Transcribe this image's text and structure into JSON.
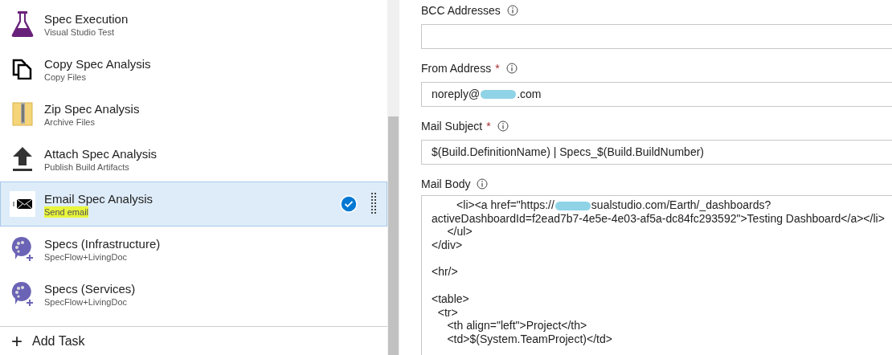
{
  "tasks": [
    {
      "title": "Spec Execution",
      "subtitle": "Visual Studio Test",
      "kind": "flask",
      "selected": false,
      "highlighted": false
    },
    {
      "title": "Copy Spec Analysis",
      "subtitle": "Copy Files",
      "kind": "copy",
      "selected": false,
      "highlighted": false
    },
    {
      "title": "Zip Spec Analysis",
      "subtitle": "Archive Files",
      "kind": "zip",
      "selected": false,
      "highlighted": false
    },
    {
      "title": "Attach Spec Analysis",
      "subtitle": "Publish Build Artifacts",
      "kind": "upload",
      "selected": false,
      "highlighted": false
    },
    {
      "title": "Email Spec Analysis",
      "subtitle": "Send email",
      "kind": "email",
      "selected": true,
      "highlighted": true
    },
    {
      "title": "Specs (Infrastructure)",
      "subtitle": "SpecFlow+LivingDoc",
      "kind": "specflow",
      "selected": false,
      "highlighted": false
    },
    {
      "title": "Specs (Services)",
      "subtitle": "SpecFlow+LivingDoc",
      "kind": "specflow",
      "selected": false,
      "highlighted": false
    }
  ],
  "add_task": {
    "icon": "+",
    "label": "Add Task"
  },
  "fields": [
    {
      "label": "BCC Addresses",
      "required": false
    },
    {
      "label": "From Address",
      "required": true,
      "value_parts": [
        "noreply@",
        ".com"
      ]
    },
    {
      "label": "Mail Subject",
      "required": true,
      "value_parts": [
        "$(Build.DefinitionName) | Specs_$(Build.BuildNumber)"
      ]
    }
  ],
  "required_mark": "*",
  "mail_body": {
    "label": "Mail Body",
    "lines": [
      {
        "kind": "code",
        "parts": [
          "        <li><a href=\"https://",
          "sualstudio.com/Earth/_dashboards?"
        ]
      },
      {
        "kind": "code",
        "parts": [
          "activeDashboardId=f2ead7b7-4e5e-4e03-af5a-dc84fc293592\">Testing Dashboard</a></li>"
        ]
      },
      {
        "kind": "code",
        "parts": [
          "     </ul>"
        ]
      },
      {
        "kind": "code",
        "parts": [
          "</div>"
        ]
      },
      {
        "kind": "blank"
      },
      {
        "kind": "code",
        "parts": [
          "<hr/>"
        ]
      },
      {
        "kind": "blank"
      },
      {
        "kind": "code",
        "parts": [
          "<table>"
        ]
      },
      {
        "kind": "code",
        "parts": [
          "  <tr>"
        ]
      },
      {
        "kind": "code",
        "parts": [
          "     <th align=\"left\">Project</th>"
        ]
      },
      {
        "kind": "code",
        "parts": [
          "     <td>$(System.TeamProject)</td>"
        ]
      }
    ]
  }
}
